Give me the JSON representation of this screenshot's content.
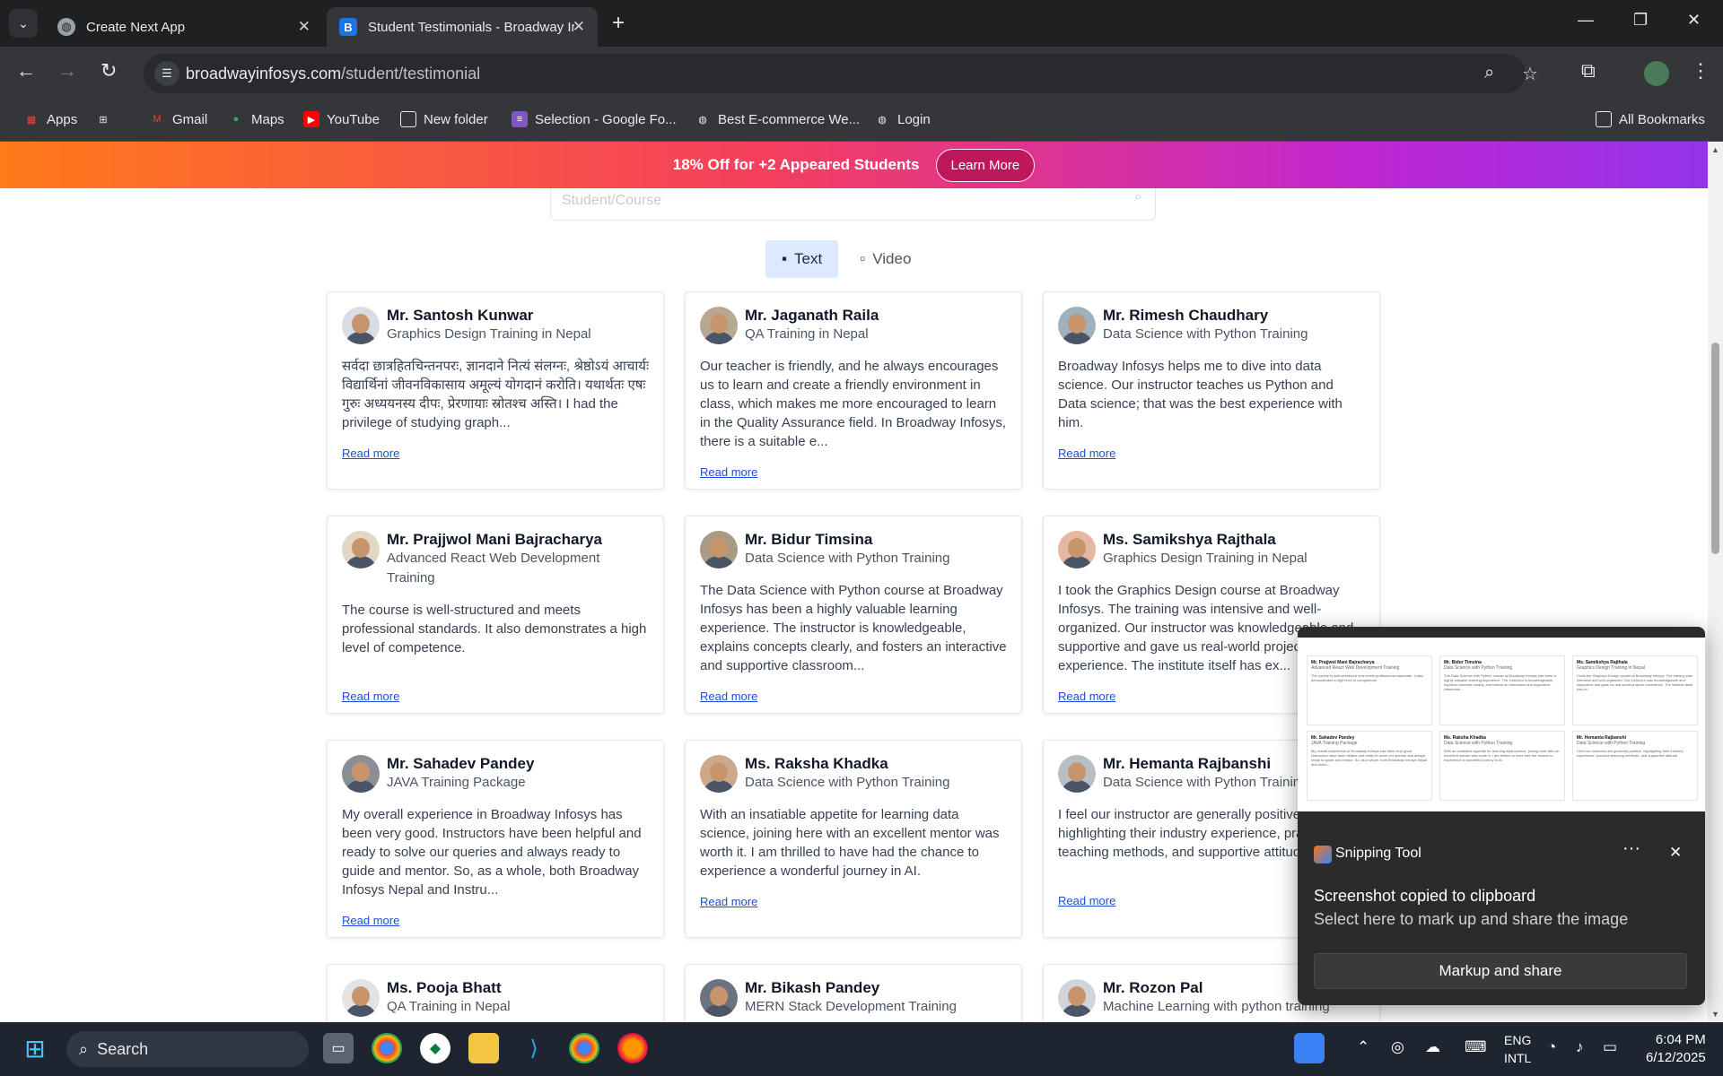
{
  "browser": {
    "tabs": [
      {
        "title": "Create Next App",
        "active": false
      },
      {
        "title": "Student Testimonials - Broadway Ir",
        "active": true
      }
    ],
    "url_domain": "broadwayinfosys.com",
    "url_path": "/student/testimonial",
    "bookmarks": [
      "Apps",
      "Gmail",
      "Maps",
      "YouTube",
      "New folder",
      "Selection - Google Fo...",
      "Best E-commerce We...",
      "Login"
    ],
    "all_bookmarks": "All Bookmarks"
  },
  "banner": {
    "text": "18% Off for +2 Appeared Students",
    "button": "Learn More"
  },
  "search": {
    "placeholder": "Student/Course"
  },
  "toggle": {
    "text": "Text",
    "video": "Video"
  },
  "read_more": "Read more",
  "testimonials": [
    {
      "name": "Mr. Santosh Kunwar",
      "course": "Graphics Design Training in Nepal",
      "text": "सर्वदा छात्रहितचिन्तनपरः, ज्ञानदाने नित्यं संलग्नः, श्रेष्ठोऽयं आचार्यः विद्यार्थिनां जीवनविकासाय अमूल्यं योगदानं करोति। यथार्थतः एषः गुरुः अध्ययनस्य दीपः, प्रेरणायाः स्रोतश्च अस्ति। I had the privilege of studying graph...",
      "read_more": "Read more"
    },
    {
      "name": "Mr. Jaganath Raila",
      "course": "QA Training in Nepal",
      "text": "Our teacher is friendly, and he always encourages us to learn and create a friendly environment in class, which makes me more encouraged to learn in the Quality Assurance field. In Broadway Infosys, there is a suitable e...",
      "read_more": "Read more"
    },
    {
      "name": "Mr. Rimesh Chaudhary",
      "course": "Data Science with Python Training",
      "text": "Broadway Infosys helps me to dive into data science. Our instructor teaches us Python and Data science; that was the best experience with him.",
      "read_more": "Read more"
    },
    {
      "name": "Mr. Prajjwol Mani Bajracharya",
      "course": "Advanced React Web Development Training",
      "text": "The course is well-structured and meets professional standards. It also demonstrates a high level of competence.",
      "read_more": "Read more"
    },
    {
      "name": "Mr. Bidur Timsina",
      "course": "Data Science with Python Training",
      "text": "The Data Science with Python course at Broadway Infosys has been a highly valuable learning experience. The instructor is knowledgeable, explains concepts clearly, and fosters an interactive and supportive classroom...",
      "read_more": "Read more"
    },
    {
      "name": "Ms. Samikshya Rajthala",
      "course": "Graphics Design Training in Nepal",
      "text": "I took the Graphics Design course at Broadway Infosys. The training was intensive and well-organized. Our instructor was knowledgeable and supportive and gave us real-world projects experience. The institute itself has ex...",
      "read_more": "Read more"
    },
    {
      "name": "Mr. Sahadev Pandey",
      "course": "JAVA Training Package",
      "text": "My overall experience in Broadway Infosys has been very good. Instructors have been helpful and ready to solve our queries and always ready to guide and mentor. So, as a whole, both Broadway Infosys Nepal and Instru...",
      "read_more": "Read more"
    },
    {
      "name": "Ms. Raksha Khadka",
      "course": "Data Science with Python Training",
      "text": "With an insatiable appetite for learning data science, joining here with an excellent mentor was worth it. I am thrilled to have had the chance to experience a wonderful journey in AI.",
      "read_more": "Read more"
    },
    {
      "name": "Mr. Hemanta Rajbanshi",
      "course": "Data Science with Python Training",
      "text": "I feel our instructor are generally positive, highlighting their industry experience, practical teaching methods, and supportive attitude.",
      "read_more": "Read more"
    },
    {
      "name": "Ms. Pooja Bhatt",
      "course": "QA Training in Nepal",
      "text": "",
      "read_more": ""
    },
    {
      "name": "Mr. Bikash Pandey",
      "course": "MERN Stack Development Training",
      "text": "",
      "read_more": ""
    },
    {
      "name": "Mr. Rozon Pal",
      "course": "Machine Learning with python training",
      "text": "",
      "read_more": ""
    }
  ],
  "snipping_tool": {
    "title": "Snipping Tool",
    "message1": "Screenshot copied to clipboard",
    "message2": "Select here to mark up and share the image",
    "button": "Markup and share"
  },
  "taskbar": {
    "search": "Search",
    "lang1": "ENG",
    "lang2": "INTL",
    "time": "6:04 PM",
    "date": "6/12/2025"
  }
}
